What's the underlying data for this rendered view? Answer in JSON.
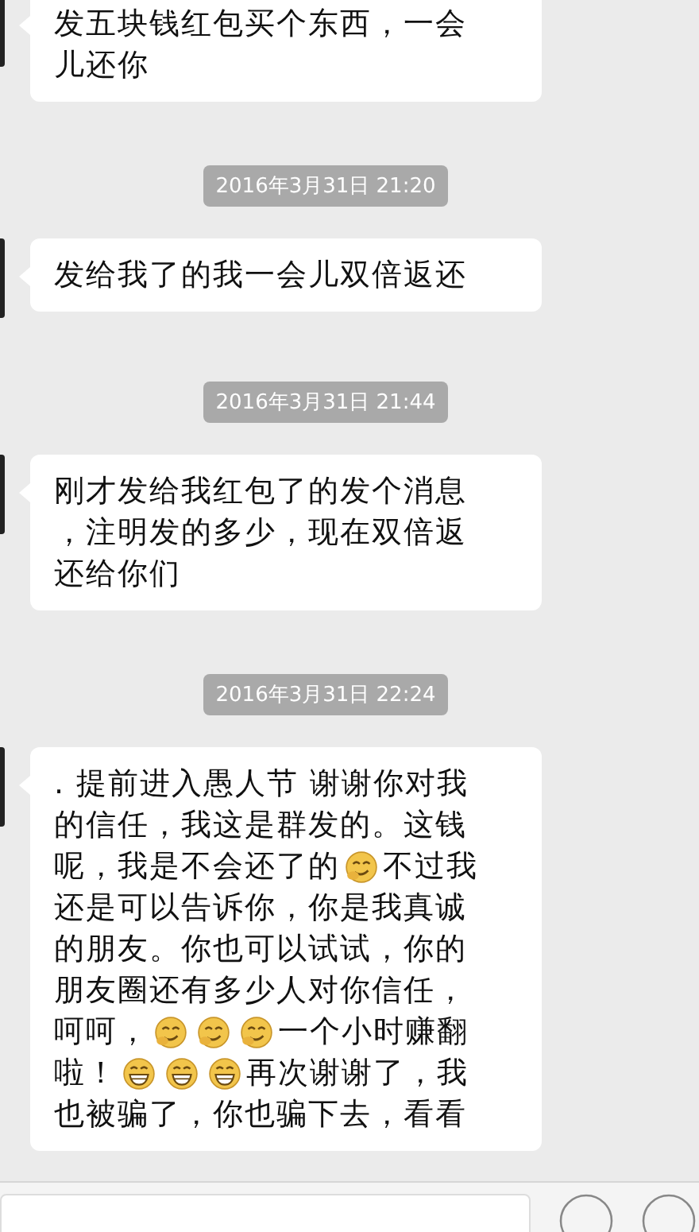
{
  "messages": [
    {
      "kind": "message",
      "lines": [
        [
          {
            "kind": "text",
            "text": "发五块钱红包买个东西，一会"
          }
        ],
        [
          {
            "kind": "text",
            "text": "儿还你"
          }
        ]
      ]
    },
    {
      "kind": "time",
      "text": "2016年3月31日 21:20"
    },
    {
      "kind": "message",
      "lines": [
        [
          {
            "kind": "text",
            "text": "发给我了的我一会儿双倍返还"
          }
        ]
      ]
    },
    {
      "kind": "time",
      "text": "2016年3月31日 21:44"
    },
    {
      "kind": "message",
      "lines": [
        [
          {
            "kind": "text",
            "text": "刚才发给我红包了的发个消息"
          }
        ],
        [
          {
            "kind": "text",
            "text": "，注明发的多少，现在双倍返"
          }
        ],
        [
          {
            "kind": "text",
            "text": "还给你们"
          }
        ]
      ]
    },
    {
      "kind": "time",
      "text": "2016年3月31日 22:24"
    },
    {
      "kind": "message",
      "lines": [
        [
          {
            "kind": "text",
            "text": ". 提前进入愚人节 谢谢你对我"
          }
        ],
        [
          {
            "kind": "text",
            "text": "的信任，我这是群发的。这钱"
          }
        ],
        [
          {
            "kind": "text",
            "text": "呢，我是不会还了的"
          },
          {
            "kind": "smirk"
          },
          {
            "kind": "text",
            "text": "不过我"
          }
        ],
        [
          {
            "kind": "text",
            "text": "还是可以告诉你，你是我真诚"
          }
        ],
        [
          {
            "kind": "text",
            "text": "的朋友。你也可以试试，你的"
          }
        ],
        [
          {
            "kind": "text",
            "text": "朋友圈还有多少人对你信任，"
          }
        ],
        [
          {
            "kind": "text",
            "text": "呵呵，"
          },
          {
            "kind": "smirk"
          },
          {
            "kind": "smirk"
          },
          {
            "kind": "smirk"
          },
          {
            "kind": "text",
            "text": "一个小时赚翻"
          }
        ],
        [
          {
            "kind": "text",
            "text": "啦！"
          },
          {
            "kind": "grin"
          },
          {
            "kind": "grin"
          },
          {
            "kind": "grin"
          },
          {
            "kind": "text",
            "text": "再次谢谢了，我"
          }
        ],
        [
          {
            "kind": "text",
            "text": "也被骗了，你也骗下去，看看"
          }
        ]
      ]
    }
  ]
}
